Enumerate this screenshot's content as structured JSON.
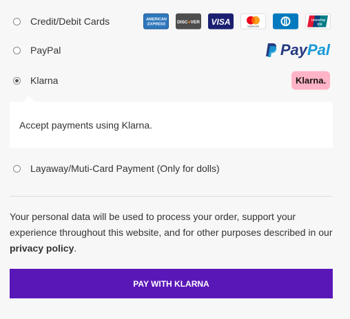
{
  "payment_options": [
    {
      "label": "Credit/Debit Cards",
      "selected": false
    },
    {
      "label": "PayPal",
      "selected": false
    },
    {
      "label": "Klarna",
      "selected": true
    },
    {
      "label": "Layaway/Muti-Card Payment (Only for dolls)",
      "selected": false
    }
  ],
  "card_logos": {
    "amex": "AMERICAN EXPRESS",
    "discover": "DISCOVER",
    "visa": "VISA",
    "mastercard": "mastercard",
    "diners": "Diners Club",
    "unionpay": "UnionPay 银联"
  },
  "paypal_logo": {
    "part1": "Pay",
    "part2": "Pal"
  },
  "klarna_badge": "Klarna.",
  "klarna_description": "Accept payments using Klarna.",
  "privacy": {
    "text": "Your personal data will be used to process your order, support your experience throughout this website, and for other purposes described in our ",
    "link": "privacy policy",
    "end": "."
  },
  "pay_button": "PAY WITH KLARNA",
  "colors": {
    "button_bg": "#5a17b8",
    "klarna_pink": "#ffb3c7",
    "paypal_dark": "#253b80",
    "paypal_light": "#179bd7"
  }
}
